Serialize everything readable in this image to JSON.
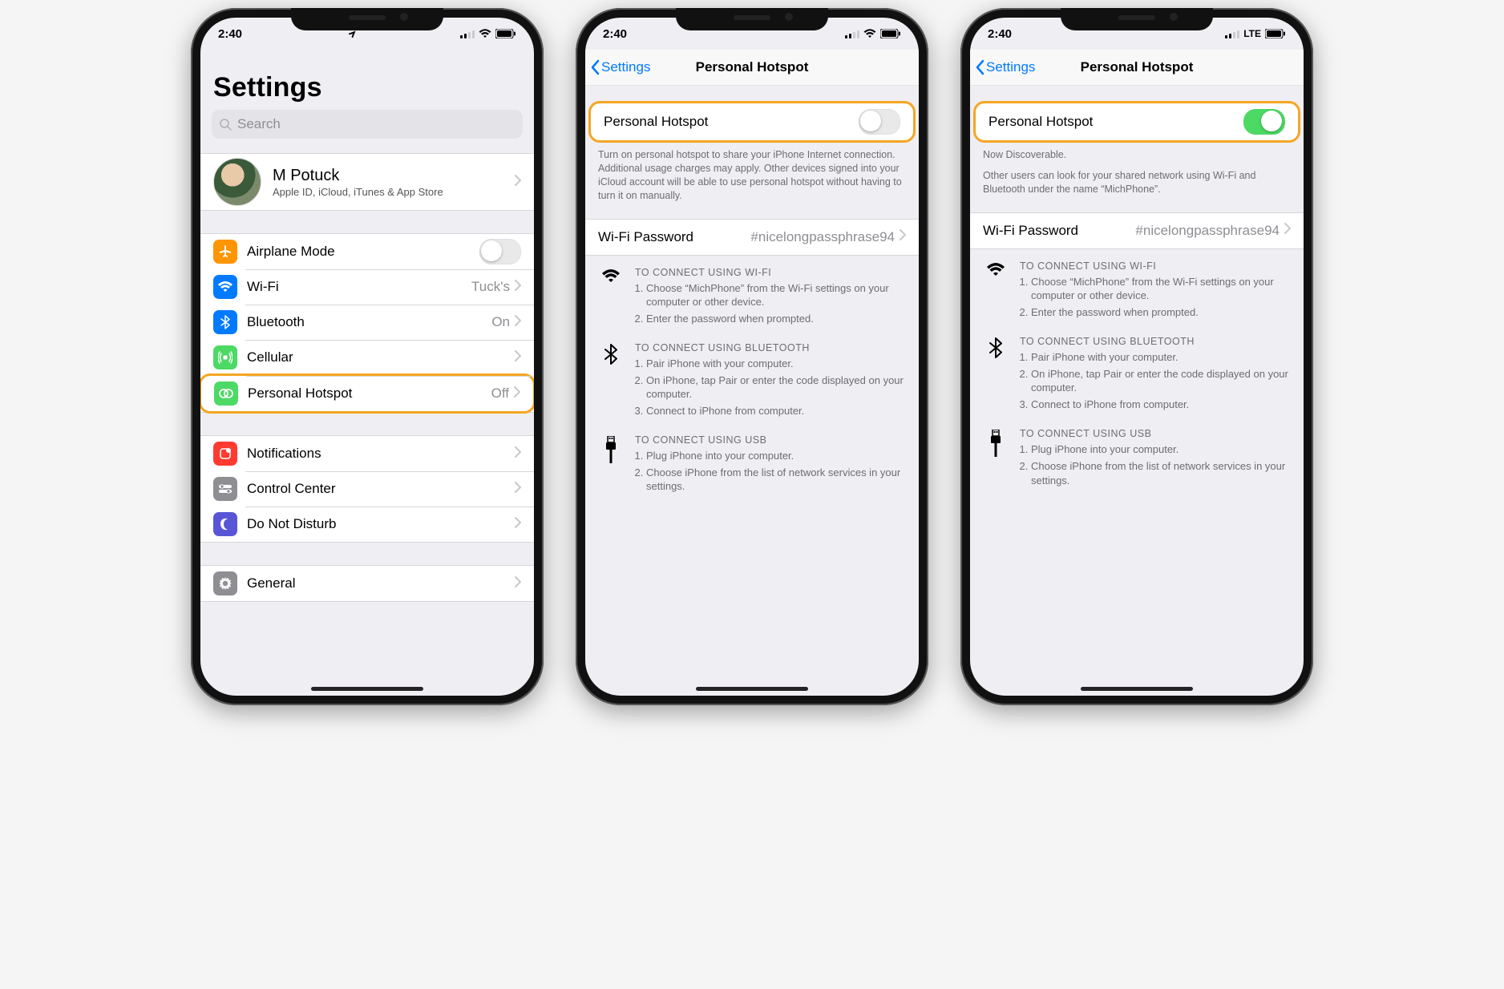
{
  "status": {
    "time": "2:40",
    "lte": "LTE"
  },
  "phone1": {
    "title": "Settings",
    "search": "Search",
    "profile": {
      "name": "M Potuck",
      "sub": "Apple ID, iCloud, iTunes & App Store"
    },
    "rows": {
      "airplane": "Airplane Mode",
      "wifi": "Wi-Fi",
      "wifi_val": "Tuck's",
      "bt": "Bluetooth",
      "bt_val": "On",
      "cell": "Cellular",
      "hotspot": "Personal Hotspot",
      "hotspot_val": "Off",
      "notif": "Notifications",
      "cc": "Control Center",
      "dnd": "Do Not Disturb",
      "general": "General"
    }
  },
  "phone2": {
    "back": "Settings",
    "title": "Personal Hotspot",
    "toggle_label": "Personal Hotspot",
    "footer": "Turn on personal hotspot to share your iPhone Internet connection. Additional usage charges may apply. Other devices signed into your iCloud account will be able to use personal hotspot without having to turn it on manually.",
    "pw_label": "Wi-Fi Password",
    "pw_value": "#nicelongpassphrase94",
    "wifi_title": "TO CONNECT USING WI-FI",
    "wifi_steps": [
      "Choose “MichPhone” from the Wi-Fi settings on your computer or other device.",
      "Enter the password when prompted."
    ],
    "bt_title": "TO CONNECT USING BLUETOOTH",
    "bt_steps": [
      "Pair iPhone with your computer.",
      "On iPhone, tap Pair or enter the code displayed on your computer.",
      "Connect to iPhone from computer."
    ],
    "usb_title": "TO CONNECT USING USB",
    "usb_steps": [
      "Plug iPhone into your computer.",
      "Choose iPhone from the list of network services in your settings."
    ]
  },
  "phone3": {
    "back": "Settings",
    "title": "Personal Hotspot",
    "toggle_label": "Personal Hotspot",
    "discover": "Now Discoverable.",
    "discover_sub": "Other users can look for your shared network using Wi-Fi and Bluetooth under the name “MichPhone”.",
    "pw_label": "Wi-Fi Password",
    "pw_value": "#nicelongpassphrase94",
    "wifi_title": "TO CONNECT USING WI-FI",
    "wifi_steps": [
      "Choose “MichPhone” from the Wi-Fi settings on your computer or other device.",
      "Enter the password when prompted."
    ],
    "bt_title": "TO CONNECT USING BLUETOOTH",
    "bt_steps": [
      "Pair iPhone with your computer.",
      "On iPhone, tap Pair or enter the code displayed on your computer.",
      "Connect to iPhone from computer."
    ],
    "usb_title": "TO CONNECT USING USB",
    "usb_steps": [
      "Plug iPhone into your computer.",
      "Choose iPhone from the list of network services in your settings."
    ]
  }
}
